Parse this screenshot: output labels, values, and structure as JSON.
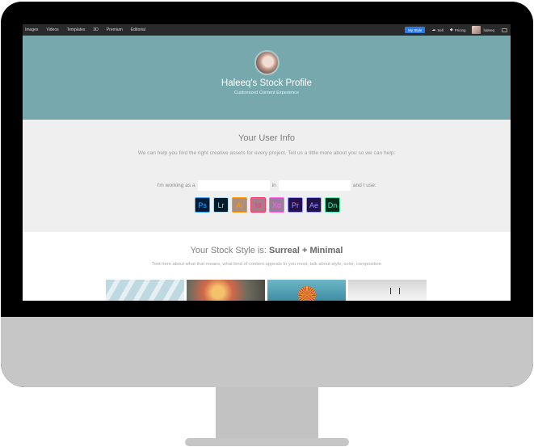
{
  "nav": {
    "links": [
      "Images",
      "Videos",
      "Templates",
      "3D",
      "Premium",
      "Editorial"
    ],
    "my_style": "My Style",
    "sell": "Sell",
    "pricing": "Pricing",
    "user": "haleeq"
  },
  "hero": {
    "title": "Haleeq's Stock Profile",
    "subtitle": "Customized Content Experience",
    "bg_color": "#76a8ae"
  },
  "user_info": {
    "title": "Your User Info",
    "description": "We can help you find the right creative assets for every project. Tell us a little more about you so we can help:",
    "working_as": "I'm working as a",
    "in": "in",
    "and_i_use": "and I use:",
    "role_value": "",
    "field_value": ""
  },
  "apps": [
    {
      "abbr": "Ps",
      "name": "photoshop-icon",
      "color": "#31a8ff",
      "bg": "#001e36"
    },
    {
      "abbr": "Lr",
      "name": "lightroom-icon",
      "color": "#add5ec",
      "bg": "#001a26"
    },
    {
      "abbr": "Ai",
      "name": "illustrator-icon",
      "color": "#ff9a00",
      "bg": "#ae8f7a"
    },
    {
      "abbr": "Id",
      "name": "indesign-icon",
      "color": "#ff3366",
      "bg": "#a57d8f"
    },
    {
      "abbr": "Xd",
      "name": "xd-icon",
      "color": "#ff61f6",
      "bg": "#9a7e99"
    },
    {
      "abbr": "Pr",
      "name": "premiere-icon",
      "color": "#9999ff",
      "bg": "#2a1048"
    },
    {
      "abbr": "Ae",
      "name": "after-effects-icon",
      "color": "#9999ff",
      "bg": "#23124a"
    },
    {
      "abbr": "Dn",
      "name": "dimension-icon",
      "color": "#4ff0ad",
      "bg": "#0a2a1f"
    }
  ],
  "stock_style": {
    "prefix": "Your Stock Style is: ",
    "style": "Surreal + Minimal",
    "description": "Text here about what that means, what kind of content appeals to you most, talk about style, color, composition"
  }
}
